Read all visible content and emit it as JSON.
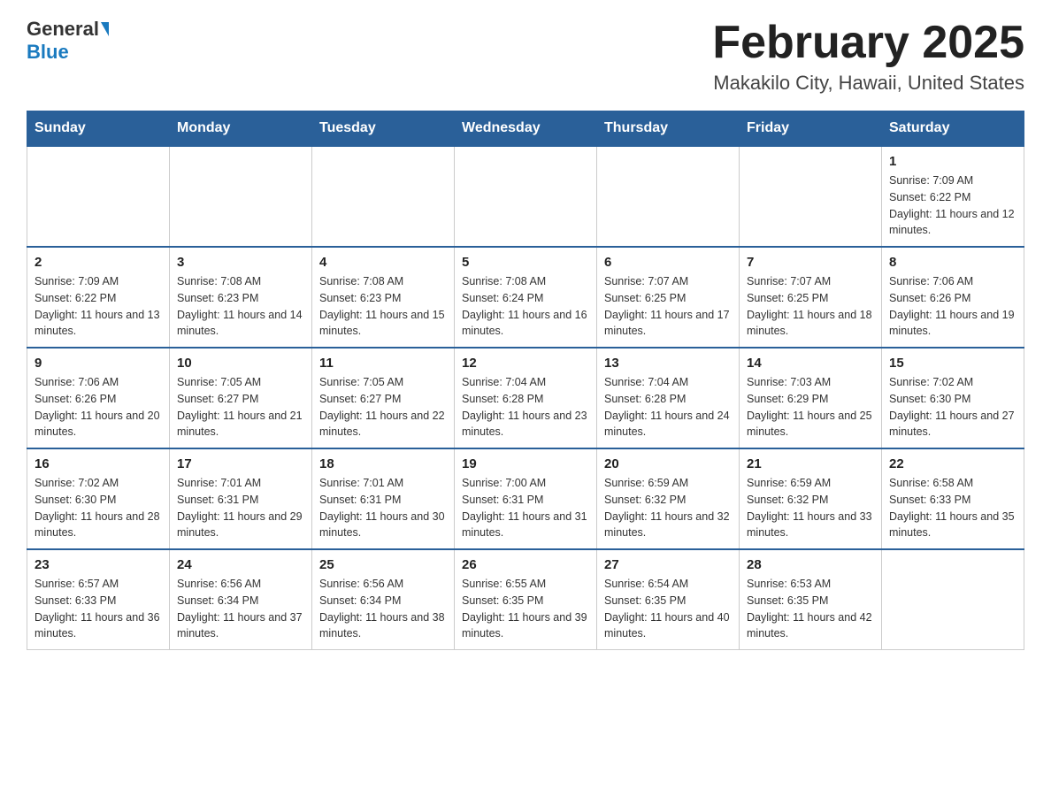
{
  "header": {
    "logo_general": "General",
    "logo_blue": "Blue",
    "title": "February 2025",
    "subtitle": "Makakilo City, Hawaii, United States"
  },
  "calendar": {
    "days_of_week": [
      "Sunday",
      "Monday",
      "Tuesday",
      "Wednesday",
      "Thursday",
      "Friday",
      "Saturday"
    ],
    "weeks": [
      [
        {
          "day": "",
          "info": ""
        },
        {
          "day": "",
          "info": ""
        },
        {
          "day": "",
          "info": ""
        },
        {
          "day": "",
          "info": ""
        },
        {
          "day": "",
          "info": ""
        },
        {
          "day": "",
          "info": ""
        },
        {
          "day": "1",
          "info": "Sunrise: 7:09 AM\nSunset: 6:22 PM\nDaylight: 11 hours and 12 minutes."
        }
      ],
      [
        {
          "day": "2",
          "info": "Sunrise: 7:09 AM\nSunset: 6:22 PM\nDaylight: 11 hours and 13 minutes."
        },
        {
          "day": "3",
          "info": "Sunrise: 7:08 AM\nSunset: 6:23 PM\nDaylight: 11 hours and 14 minutes."
        },
        {
          "day": "4",
          "info": "Sunrise: 7:08 AM\nSunset: 6:23 PM\nDaylight: 11 hours and 15 minutes."
        },
        {
          "day": "5",
          "info": "Sunrise: 7:08 AM\nSunset: 6:24 PM\nDaylight: 11 hours and 16 minutes."
        },
        {
          "day": "6",
          "info": "Sunrise: 7:07 AM\nSunset: 6:25 PM\nDaylight: 11 hours and 17 minutes."
        },
        {
          "day": "7",
          "info": "Sunrise: 7:07 AM\nSunset: 6:25 PM\nDaylight: 11 hours and 18 minutes."
        },
        {
          "day": "8",
          "info": "Sunrise: 7:06 AM\nSunset: 6:26 PM\nDaylight: 11 hours and 19 minutes."
        }
      ],
      [
        {
          "day": "9",
          "info": "Sunrise: 7:06 AM\nSunset: 6:26 PM\nDaylight: 11 hours and 20 minutes."
        },
        {
          "day": "10",
          "info": "Sunrise: 7:05 AM\nSunset: 6:27 PM\nDaylight: 11 hours and 21 minutes."
        },
        {
          "day": "11",
          "info": "Sunrise: 7:05 AM\nSunset: 6:27 PM\nDaylight: 11 hours and 22 minutes."
        },
        {
          "day": "12",
          "info": "Sunrise: 7:04 AM\nSunset: 6:28 PM\nDaylight: 11 hours and 23 minutes."
        },
        {
          "day": "13",
          "info": "Sunrise: 7:04 AM\nSunset: 6:28 PM\nDaylight: 11 hours and 24 minutes."
        },
        {
          "day": "14",
          "info": "Sunrise: 7:03 AM\nSunset: 6:29 PM\nDaylight: 11 hours and 25 minutes."
        },
        {
          "day": "15",
          "info": "Sunrise: 7:02 AM\nSunset: 6:30 PM\nDaylight: 11 hours and 27 minutes."
        }
      ],
      [
        {
          "day": "16",
          "info": "Sunrise: 7:02 AM\nSunset: 6:30 PM\nDaylight: 11 hours and 28 minutes."
        },
        {
          "day": "17",
          "info": "Sunrise: 7:01 AM\nSunset: 6:31 PM\nDaylight: 11 hours and 29 minutes."
        },
        {
          "day": "18",
          "info": "Sunrise: 7:01 AM\nSunset: 6:31 PM\nDaylight: 11 hours and 30 minutes."
        },
        {
          "day": "19",
          "info": "Sunrise: 7:00 AM\nSunset: 6:31 PM\nDaylight: 11 hours and 31 minutes."
        },
        {
          "day": "20",
          "info": "Sunrise: 6:59 AM\nSunset: 6:32 PM\nDaylight: 11 hours and 32 minutes."
        },
        {
          "day": "21",
          "info": "Sunrise: 6:59 AM\nSunset: 6:32 PM\nDaylight: 11 hours and 33 minutes."
        },
        {
          "day": "22",
          "info": "Sunrise: 6:58 AM\nSunset: 6:33 PM\nDaylight: 11 hours and 35 minutes."
        }
      ],
      [
        {
          "day": "23",
          "info": "Sunrise: 6:57 AM\nSunset: 6:33 PM\nDaylight: 11 hours and 36 minutes."
        },
        {
          "day": "24",
          "info": "Sunrise: 6:56 AM\nSunset: 6:34 PM\nDaylight: 11 hours and 37 minutes."
        },
        {
          "day": "25",
          "info": "Sunrise: 6:56 AM\nSunset: 6:34 PM\nDaylight: 11 hours and 38 minutes."
        },
        {
          "day": "26",
          "info": "Sunrise: 6:55 AM\nSunset: 6:35 PM\nDaylight: 11 hours and 39 minutes."
        },
        {
          "day": "27",
          "info": "Sunrise: 6:54 AM\nSunset: 6:35 PM\nDaylight: 11 hours and 40 minutes."
        },
        {
          "day": "28",
          "info": "Sunrise: 6:53 AM\nSunset: 6:35 PM\nDaylight: 11 hours and 42 minutes."
        },
        {
          "day": "",
          "info": ""
        }
      ]
    ]
  }
}
